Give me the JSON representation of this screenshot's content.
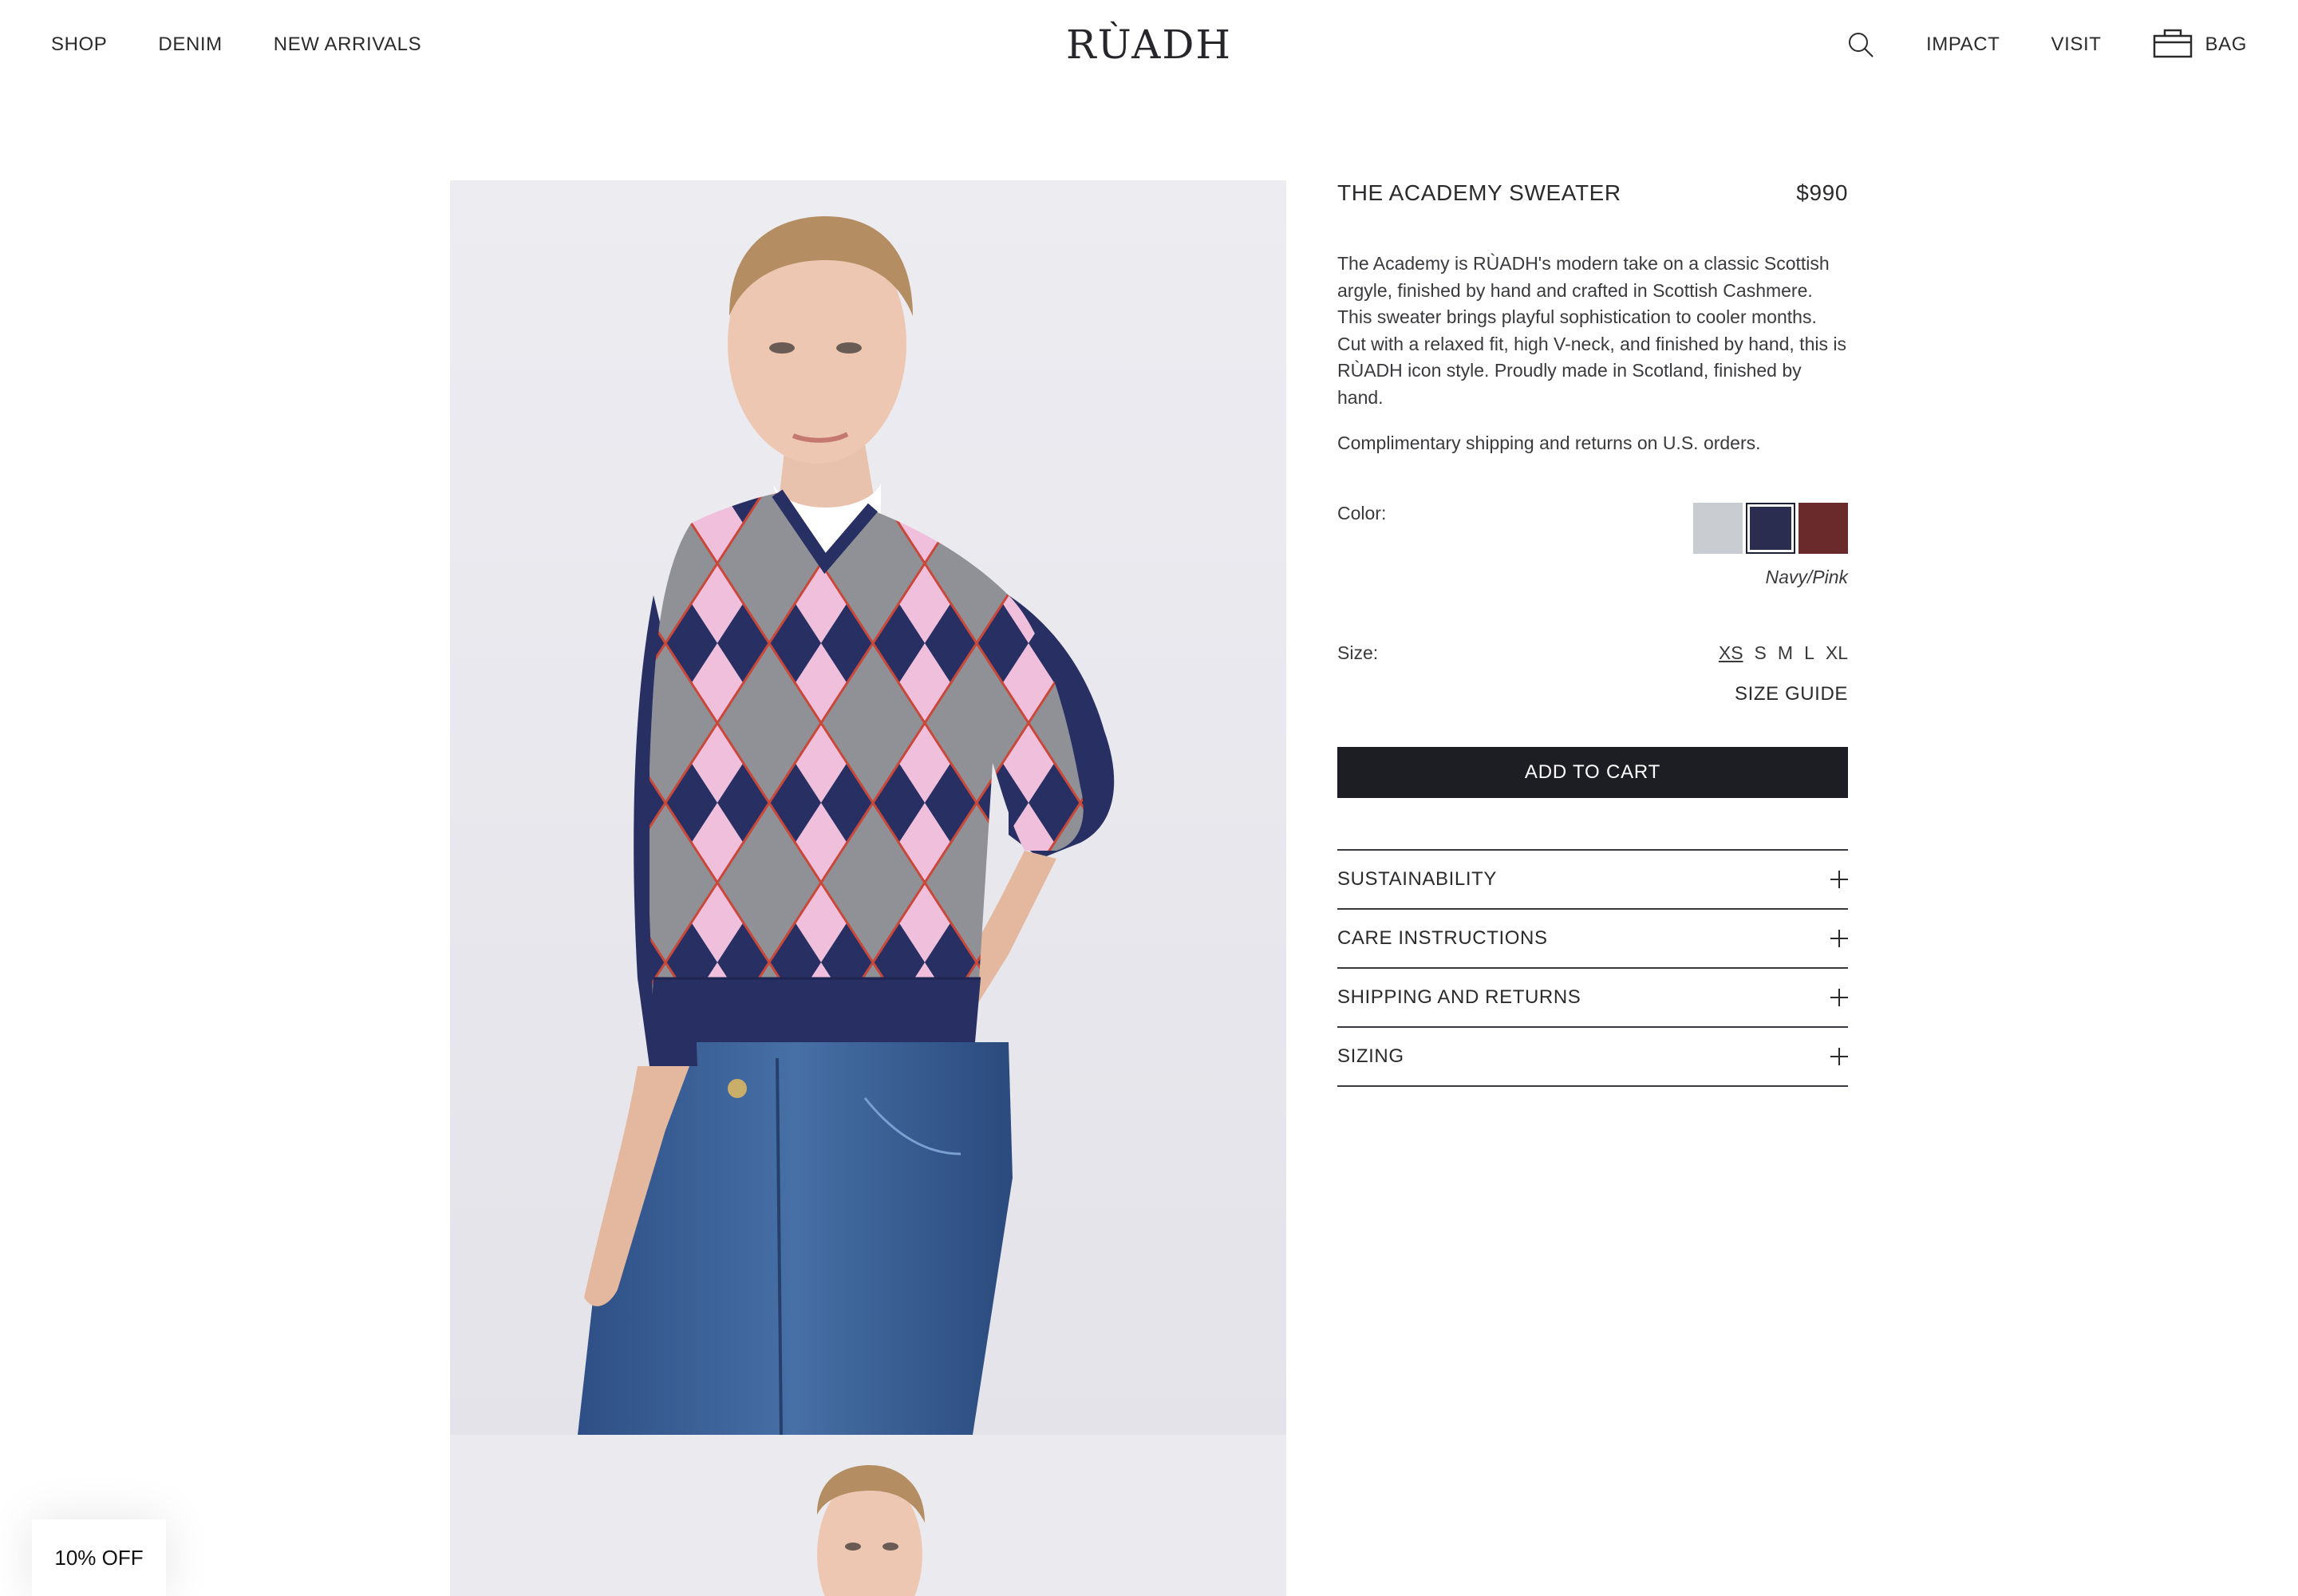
{
  "header": {
    "nav_left": [
      "SHOP",
      "DENIM",
      "NEW ARRIVALS"
    ],
    "logo": "RÙADH",
    "nav_right": [
      "IMPACT",
      "VISIT"
    ],
    "bag_label": "BAG",
    "icons": {
      "search": "search-icon",
      "bag": "bag-icon"
    }
  },
  "product": {
    "name": "THE ACADEMY SWEATER",
    "price": "$990",
    "description": "The Academy is RÙADH's modern take on a classic Scottish argyle, finished by hand and crafted in Scottish Cashmere. This sweater brings playful sophistication to cooler months. Cut with a relaxed fit, high V-neck, and finished by hand, this is RÙADH icon style. Proudly made in Scotland, finished by hand.",
    "shipping_note": "Complimentary shipping and returns on U.S. orders.",
    "color_label": "Color:",
    "colors": [
      {
        "hex": "#c9ccd0"
      },
      {
        "hex": "#2a2d50",
        "selected": true
      },
      {
        "hex": "#6a2a2c"
      }
    ],
    "selected_color_name": "Navy/Pink",
    "size_label": "Size:",
    "sizes": [
      "XS",
      "S",
      "M",
      "L",
      "XL"
    ],
    "selected_size": "XS",
    "size_guide": "SIZE GUIDE",
    "add_to_cart": "ADD TO CART",
    "accordion": [
      "SUSTAINABILITY",
      "CARE INSTRUCTIONS",
      "SHIPPING AND RETURNS",
      "SIZING"
    ]
  },
  "promo": {
    "label": "10% OFF"
  },
  "colors": {
    "text": "#2b2b2e",
    "button_bg": "#1d1d24",
    "photo_bg": "#ebebf0",
    "sweater_navy": "#283063",
    "argyle_pink": "#efbfdc",
    "argyle_gray": "#8f9196",
    "argyle_red": "#c9483a",
    "denim": "#3d5f93"
  }
}
